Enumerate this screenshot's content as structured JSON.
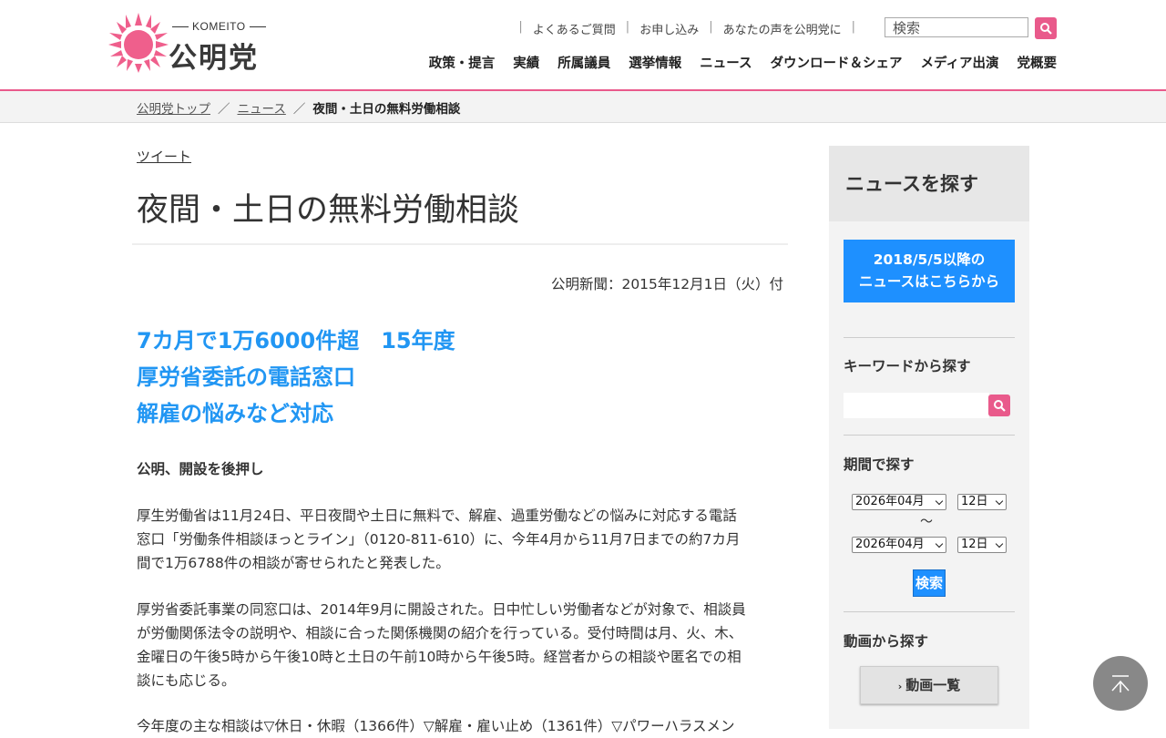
{
  "header": {
    "logo_sub": "KOMEITO",
    "logo_main": "公明党",
    "util_links": [
      "よくあるご質問",
      "お申し込み",
      "あなたの声を公明党に"
    ],
    "search_placeholder": "検索",
    "nav": [
      "政策・提言",
      "実績",
      "所属議員",
      "選挙情報",
      "ニュース",
      "ダウンロード＆シェア",
      "メディア出演",
      "党概要"
    ],
    "accent_color": "#e95a8b"
  },
  "breadcrumb": {
    "home": "公明党トップ",
    "news": "ニュース",
    "current": "夜間・土日の無料労働相談",
    "separator": "／"
  },
  "article": {
    "tweet": "ツイート",
    "title": "夜間・土日の無料労働相談",
    "date": "公明新聞：2015年12月1日（火）付",
    "lead": [
      "7カ月で1万6000件超　15年度",
      "厚労省委託の電話窓口",
      "解雇の悩みなど対応"
    ],
    "subhead": "公明、開設を後押し",
    "paragraphs": [
      [
        "厚生労働省は11月24日、平日夜間や土日に無料で、解雇、過重労働などの悩みに対応する電話",
        "窓口「労働条件相談ほっとライン」（0120-811-610）に、今年4月から11月7日までの約7カ月",
        "間で1万6788件の相談が寄せられたと発表した。"
      ],
      [
        "厚労省委託事業の同窓口は、2014年9月に開設された。日中忙しい労働者などが対象で、相談員",
        "が労働関係法令の説明や、相談に合った関係機関の紹介を行っている。受付時間は月、火、木、",
        "金曜日の午後5時から午後10時と土日の午前10時から午後5時。経営者からの相談や匿名での相",
        "談にも応じる。"
      ],
      [
        "今年度の主な相談は▽休日・休暇（1366件）▽解雇・雇い止め（1361件）▽パワーハラスメン"
      ]
    ],
    "lead_color": "#2196f3"
  },
  "sidebar": {
    "heading": "ニュースを探す",
    "banner": [
      "2018/5/5以降の",
      "ニュースはこちらから"
    ],
    "keyword_label": "キーワードから探す",
    "period_label": "期間で探す",
    "from_month": "2026年04月",
    "from_day": "12日",
    "tilde": "〜",
    "to_month": "2026年04月",
    "to_day": "12日",
    "period_search": "検索",
    "video_label": "動画から探す",
    "video_button": "動画一覧",
    "banner_color": "#1e90ff"
  }
}
